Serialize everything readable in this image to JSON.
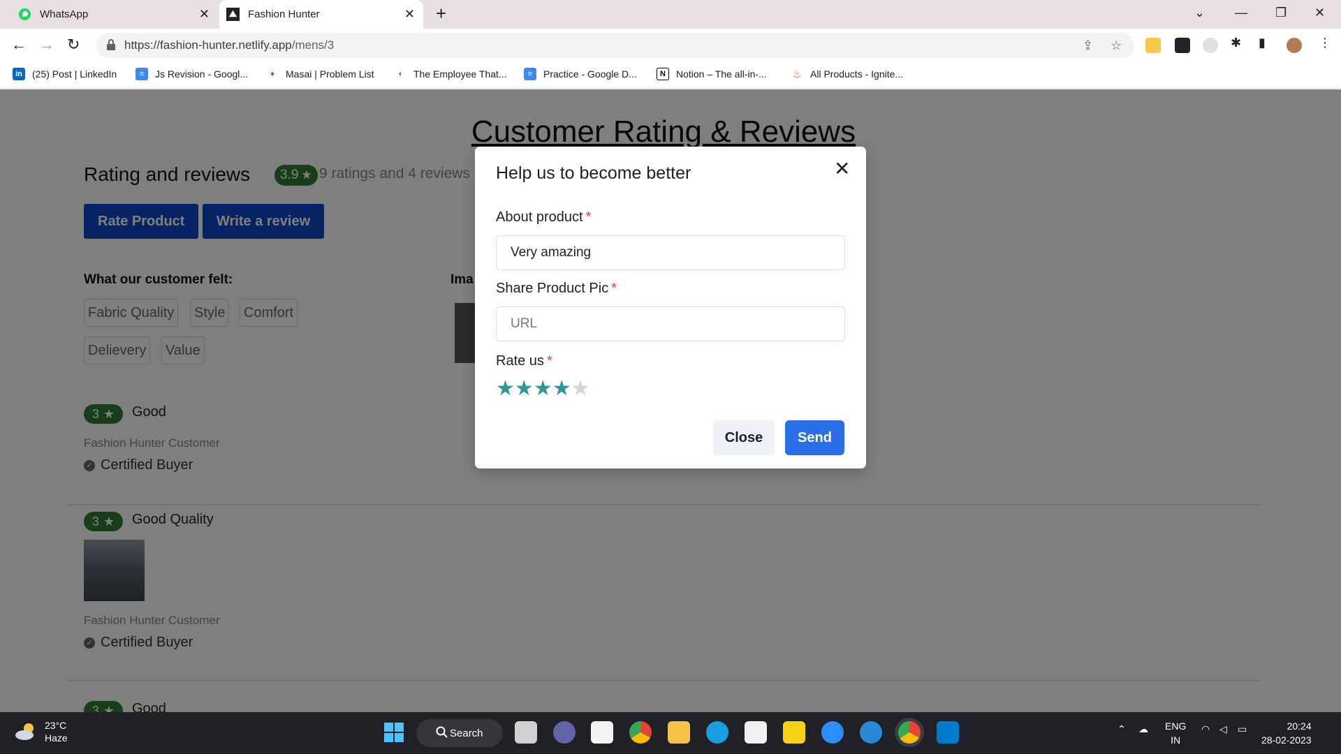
{
  "browser": {
    "tabs": [
      {
        "label": "WhatsApp",
        "icon": "whatsapp-icon",
        "active": false
      },
      {
        "label": "Fashion Hunter",
        "icon": "fashion-hunter-icon",
        "active": true
      }
    ],
    "url_host": "https://fashion-hunter.netlify.app",
    "url_path": "/mens/3",
    "bookmarks": [
      {
        "label": "(25) Post | LinkedIn",
        "icon": "linkedin-icon"
      },
      {
        "label": "Js Revision - Googl...",
        "icon": "google-docs-icon"
      },
      {
        "label": "Masai | Problem List",
        "icon": "masai-icon"
      },
      {
        "label": "The Employee That...",
        "icon": "employee-site-icon"
      },
      {
        "label": "Practice - Google D...",
        "icon": "google-docs-icon"
      },
      {
        "label": "Notion – The all-in-...",
        "icon": "notion-icon"
      },
      {
        "label": "All Products - Ignite...",
        "icon": "ignite-fire-icon"
      }
    ]
  },
  "page": {
    "heading": "Customer Rating & Reviews",
    "rating_title": "Rating and reviews",
    "avg_rating": "3.9",
    "rating_summary": "9 ratings and 4 reviews",
    "rate_button": "Rate Product",
    "review_button": "Write a review",
    "felt_label": "What our customer felt:",
    "chips": [
      "Fabric Quality",
      "Style",
      "Comfort",
      "Delievery",
      "Value"
    ],
    "images_label": "Ima",
    "reviews": [
      {
        "rating": "3",
        "title": "Good",
        "author": "Fashion Hunter Customer",
        "badge": "Certified Buyer"
      },
      {
        "rating": "3",
        "title": "Good Quality",
        "author": "Fashion Hunter Customer",
        "badge": "Certified Buyer"
      },
      {
        "rating": "3",
        "title": "Good"
      }
    ]
  },
  "modal": {
    "title": "Help us to become better",
    "about_label": "About product",
    "about_value": "Very amazing",
    "pic_label": "Share Product Pic",
    "pic_placeholder": "URL",
    "rate_label": "Rate us",
    "required_mark": "*",
    "rating_value": 4,
    "rating_max": 5,
    "star_color": "#319795",
    "star_empty_color": "#cbd5e0",
    "close_label": "Close",
    "send_label": "Send"
  },
  "taskbar": {
    "temperature": "23°C",
    "weather": "Haze",
    "search_label": "Search",
    "lang_1": "ENG",
    "lang_2": "IN",
    "time": "20:24",
    "date": "28-02-2023"
  }
}
